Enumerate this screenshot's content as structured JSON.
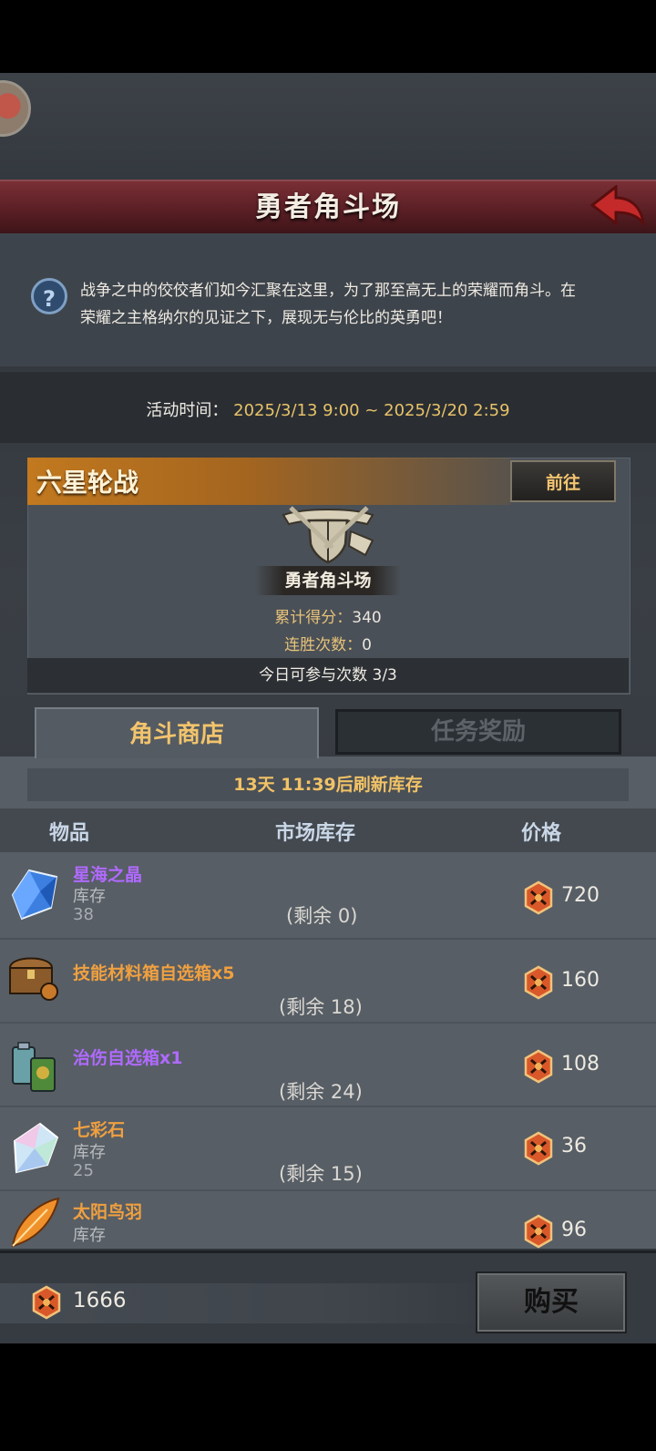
{
  "header": {
    "title": "勇者角斗场"
  },
  "intro": {
    "text": "战争之中的佼佼者们如今汇聚在这里，为了那至高无上的荣耀而角斗。在荣耀之主格纳尔的见证之下，展现无与伦比的英勇吧！"
  },
  "event_time": {
    "label": "活动时间：",
    "value": "2025/3/13 9:00 ~ 2025/3/20 2:59"
  },
  "event": {
    "title": "六星轮战",
    "goto_label": "前往",
    "arena_name": "勇者角斗场",
    "score_label": "累计得分：",
    "score_value": "340",
    "streak_label": "连胜次数：",
    "streak_value": "0",
    "attempts_text": "今日可参与次数 3/3"
  },
  "tabs": {
    "shop": "角斗商店",
    "tasks": "任务奖励"
  },
  "shop": {
    "refresh_text": "13天 11:39后刷新库存",
    "columns": {
      "item": "物品",
      "market_stock": "市场库存",
      "price": "价格"
    },
    "items": [
      {
        "name": "星海之晶",
        "name_color": "#b06aff",
        "stock_label": "库存",
        "stock": "38",
        "remaining": "(剩余 0)",
        "price": "720",
        "icon": "blue-crystal-icon"
      },
      {
        "name": "技能材料箱自选箱x5",
        "name_color": "#f0a040",
        "stock_label": "",
        "stock": "",
        "remaining": "(剩余 18)",
        "price": "160",
        "icon": "treasure-chest-icon"
      },
      {
        "name": "治伤自选箱x1",
        "name_color": "#b06aff",
        "stock_label": "",
        "stock": "",
        "remaining": "(剩余 24)",
        "price": "108",
        "icon": "potion-box-icon"
      },
      {
        "name": "七彩石",
        "name_color": "#f0a040",
        "stock_label": "库存",
        "stock": "25",
        "remaining": "(剩余 15)",
        "price": "36",
        "icon": "rainbow-stone-icon"
      },
      {
        "name": "太阳鸟羽",
        "name_color": "#f0a040",
        "stock_label": "库存",
        "stock": "",
        "remaining": "",
        "price": "96",
        "icon": "feather-icon"
      }
    ]
  },
  "footer": {
    "balance": "1666",
    "buy_label": "购买"
  }
}
